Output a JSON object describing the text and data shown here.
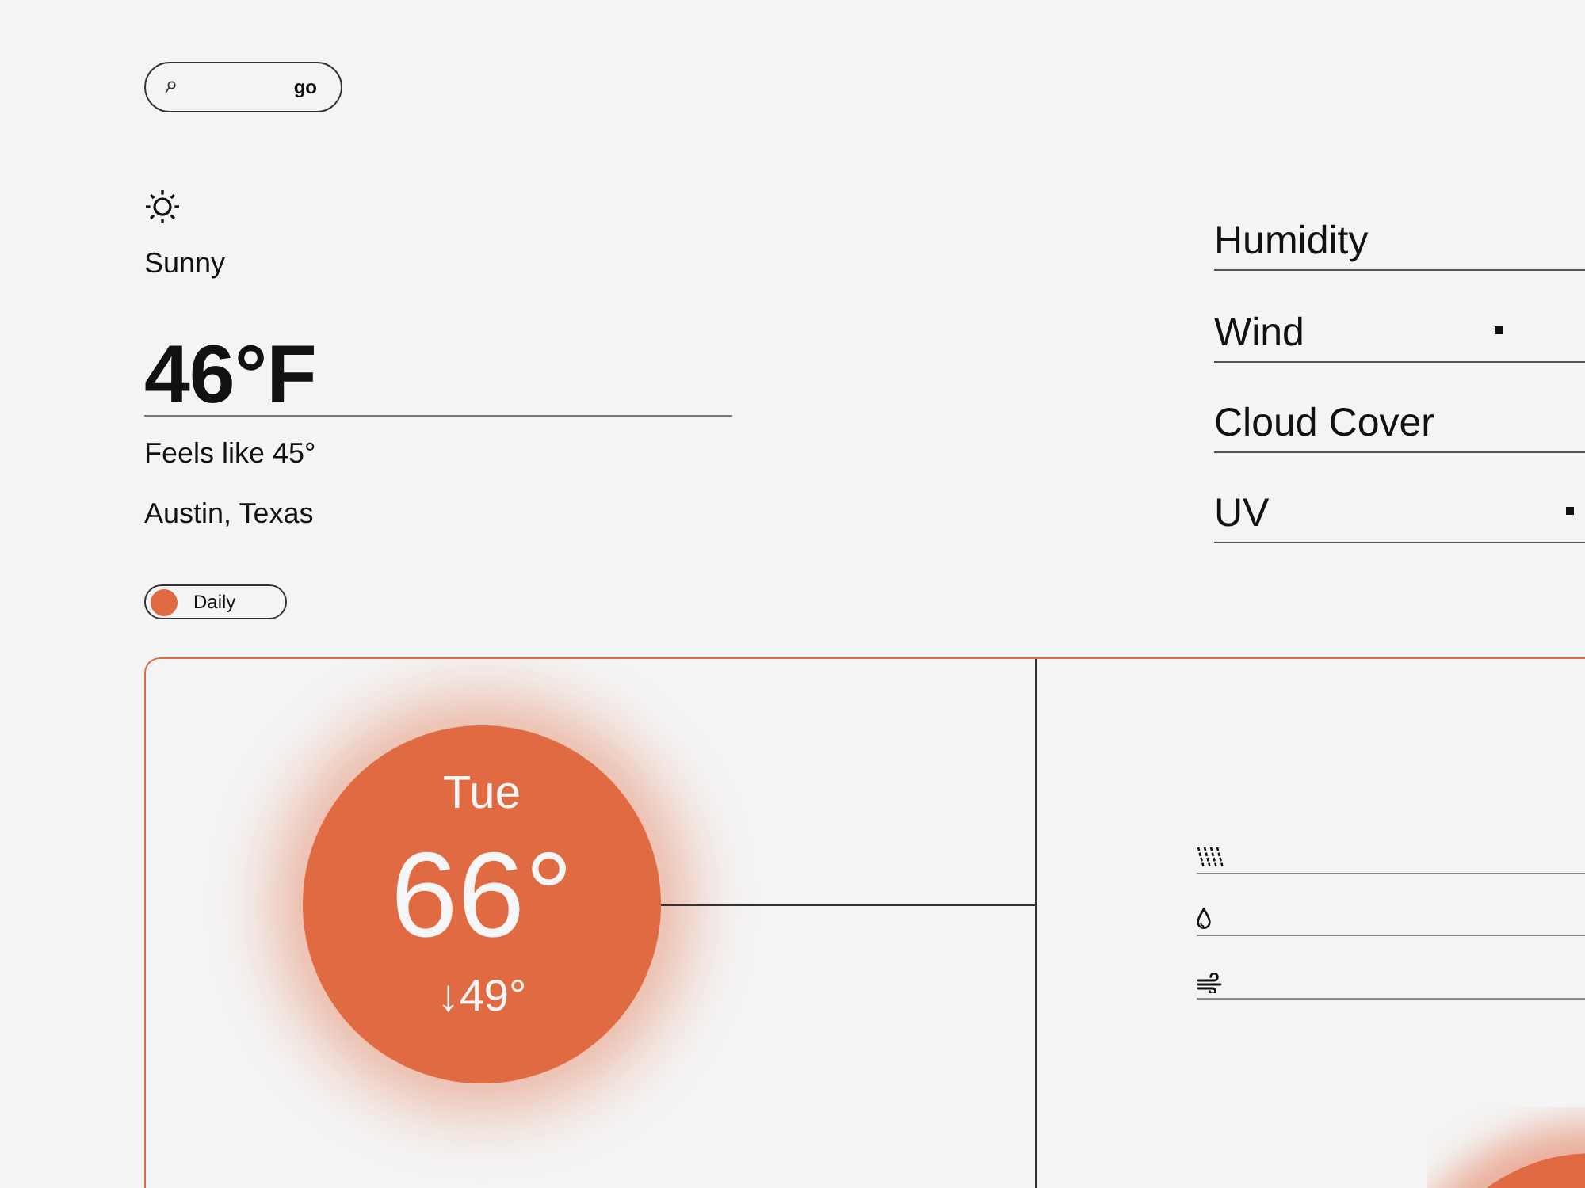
{
  "search": {
    "button": "go"
  },
  "current": {
    "condition": "Sunny",
    "temperature": "46°F",
    "feels_like": "Feels like 45°",
    "location": "Austin, Texas"
  },
  "view_toggle": {
    "label": "Daily"
  },
  "details": [
    {
      "label": "Humidity",
      "marker": false
    },
    {
      "label": "Wind",
      "marker": true
    },
    {
      "label": "Cloud Cover",
      "marker": false
    },
    {
      "label": "UV",
      "marker": true
    }
  ],
  "forecast": {
    "day": "Tue",
    "high": "66°",
    "low": "↓49°"
  },
  "conditions": [
    {
      "kind": "rain"
    },
    {
      "kind": "drop"
    },
    {
      "kind": "wind"
    }
  ]
}
